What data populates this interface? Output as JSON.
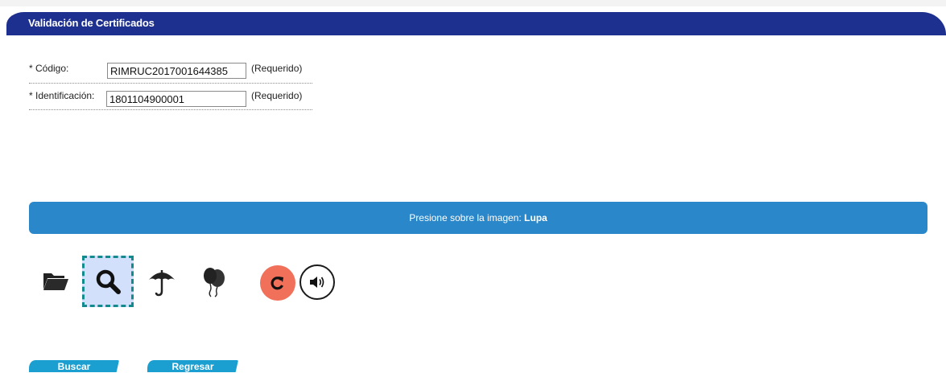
{
  "header": {
    "title": "Validación de Certificados"
  },
  "form": {
    "codigo": {
      "label": "* Código:",
      "value": "RIMRUC2017001644385",
      "required_note": "(Requerido)"
    },
    "identificacion": {
      "label": "* Identificación:",
      "value": "1801104900001",
      "required_note": "(Requerido)"
    }
  },
  "captcha": {
    "instruction_prefix": "Presione sobre la imagen:",
    "instruction_target": "Lupa",
    "icons": [
      "folder-icon",
      "magnifier-icon",
      "umbrella-icon",
      "balloons-icon"
    ],
    "selected": "magnifier-icon",
    "colors": {
      "banner": "#2a87c9",
      "selection_fill": "#d2e0fb",
      "selection_border": "#138a8e",
      "refresh": "#f0705a"
    }
  },
  "buttons": {
    "buscar": "Buscar",
    "regresar": "Regresar"
  },
  "colors": {
    "title_bar": "#1d2f8f",
    "button": "#1b9fd1"
  }
}
